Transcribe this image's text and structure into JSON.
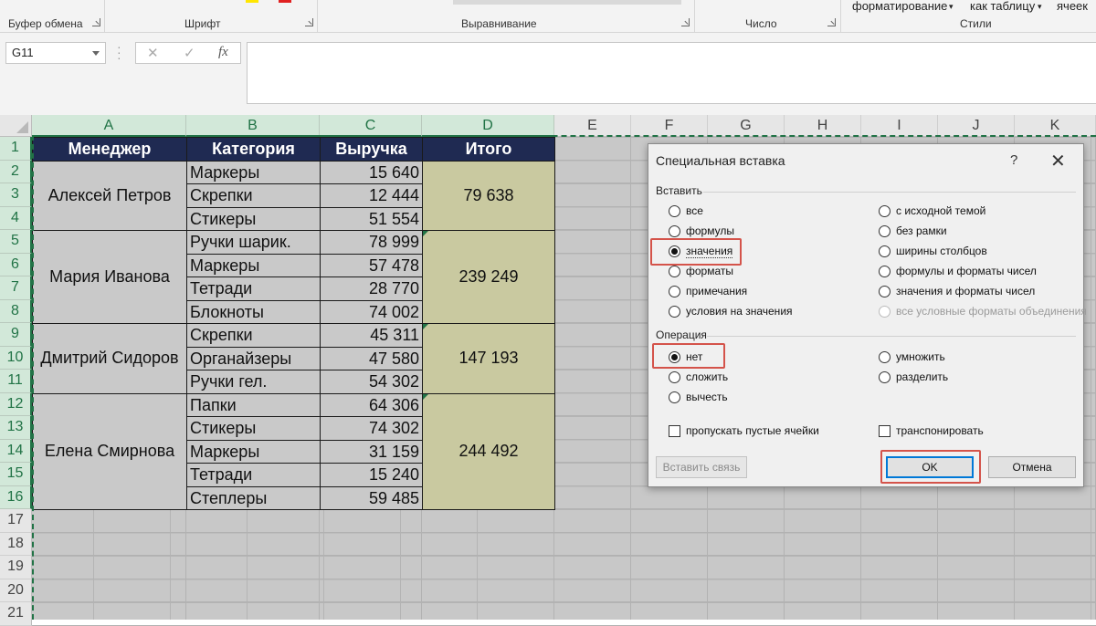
{
  "ribbon": {
    "groups": {
      "clipboard": "Буфер обмена",
      "font": "Шрифт",
      "alignment": "Выравнивание",
      "number": "Число",
      "styles": "Стили"
    },
    "top_items": [
      "форматирование",
      "как таблицу",
      "ячеек"
    ]
  },
  "formula_bar": {
    "name_box": "G11",
    "cancel_icon": "✕",
    "enter_icon": "✓",
    "fx_label": "fx",
    "value": ""
  },
  "sheet": {
    "columns": [
      "A",
      "B",
      "C",
      "D",
      "E",
      "F",
      "G",
      "H",
      "I",
      "J",
      "K"
    ],
    "rows": [
      "1",
      "2",
      "3",
      "4",
      "5",
      "6",
      "7",
      "8",
      "9",
      "10",
      "11",
      "12",
      "13",
      "14",
      "15",
      "16",
      "17",
      "18",
      "19",
      "20",
      "21"
    ],
    "headers": [
      "Менеджер",
      "Категория",
      "Выручка",
      "Итого"
    ],
    "groups": [
      {
        "manager": "Алексей Петров",
        "total": "79 638",
        "items": [
          {
            "category": "Маркеры",
            "revenue": "15 640"
          },
          {
            "category": "Скрепки",
            "revenue": "12 444"
          },
          {
            "category": "Стикеры",
            "revenue": "51 554"
          }
        ]
      },
      {
        "manager": "Мария Иванова",
        "total": "239 249",
        "items": [
          {
            "category": "Ручки шарик.",
            "revenue": "78 999"
          },
          {
            "category": "Маркеры",
            "revenue": "57 478"
          },
          {
            "category": "Тетради",
            "revenue": "28 770"
          },
          {
            "category": "Блокноты",
            "revenue": "74 002"
          }
        ]
      },
      {
        "manager": "Дмитрий Сидоров",
        "total": "147 193",
        "items": [
          {
            "category": "Скрепки",
            "revenue": "45 311"
          },
          {
            "category": "Органайзеры",
            "revenue": "47 580"
          },
          {
            "category": "Ручки гел.",
            "revenue": "54 302"
          }
        ]
      },
      {
        "manager": "Елена Смирнова",
        "total": "244 492",
        "items": [
          {
            "category": "Папки",
            "revenue": "64 306"
          },
          {
            "category": "Стикеры",
            "revenue": "74 302"
          },
          {
            "category": "Маркеры",
            "revenue": "31 159"
          },
          {
            "category": "Тетради",
            "revenue": "15 240"
          },
          {
            "category": "Степлеры",
            "revenue": "59 485"
          }
        ]
      }
    ]
  },
  "dialog": {
    "title": "Специальная вставка",
    "help": "?",
    "close": "✕",
    "paste_section": "Вставить",
    "paste_left": [
      "все",
      "формулы",
      "значения",
      "форматы",
      "примечания",
      "условия на значения"
    ],
    "paste_right": [
      "с исходной темой",
      "без рамки",
      "ширины столбцов",
      "формулы и форматы чисел",
      "значения и форматы чисел",
      "все условные форматы объединения"
    ],
    "operation_section": "Операция",
    "op_left": [
      "нет",
      "сложить",
      "вычесть"
    ],
    "op_right": [
      "умножить",
      "разделить"
    ],
    "skip_blanks": "пропускать пустые ячейки",
    "transpose": "транспонировать",
    "paste_link": "Вставить связь",
    "ok": "OK",
    "cancel": "Отмена",
    "accent": "#d4534a"
  }
}
